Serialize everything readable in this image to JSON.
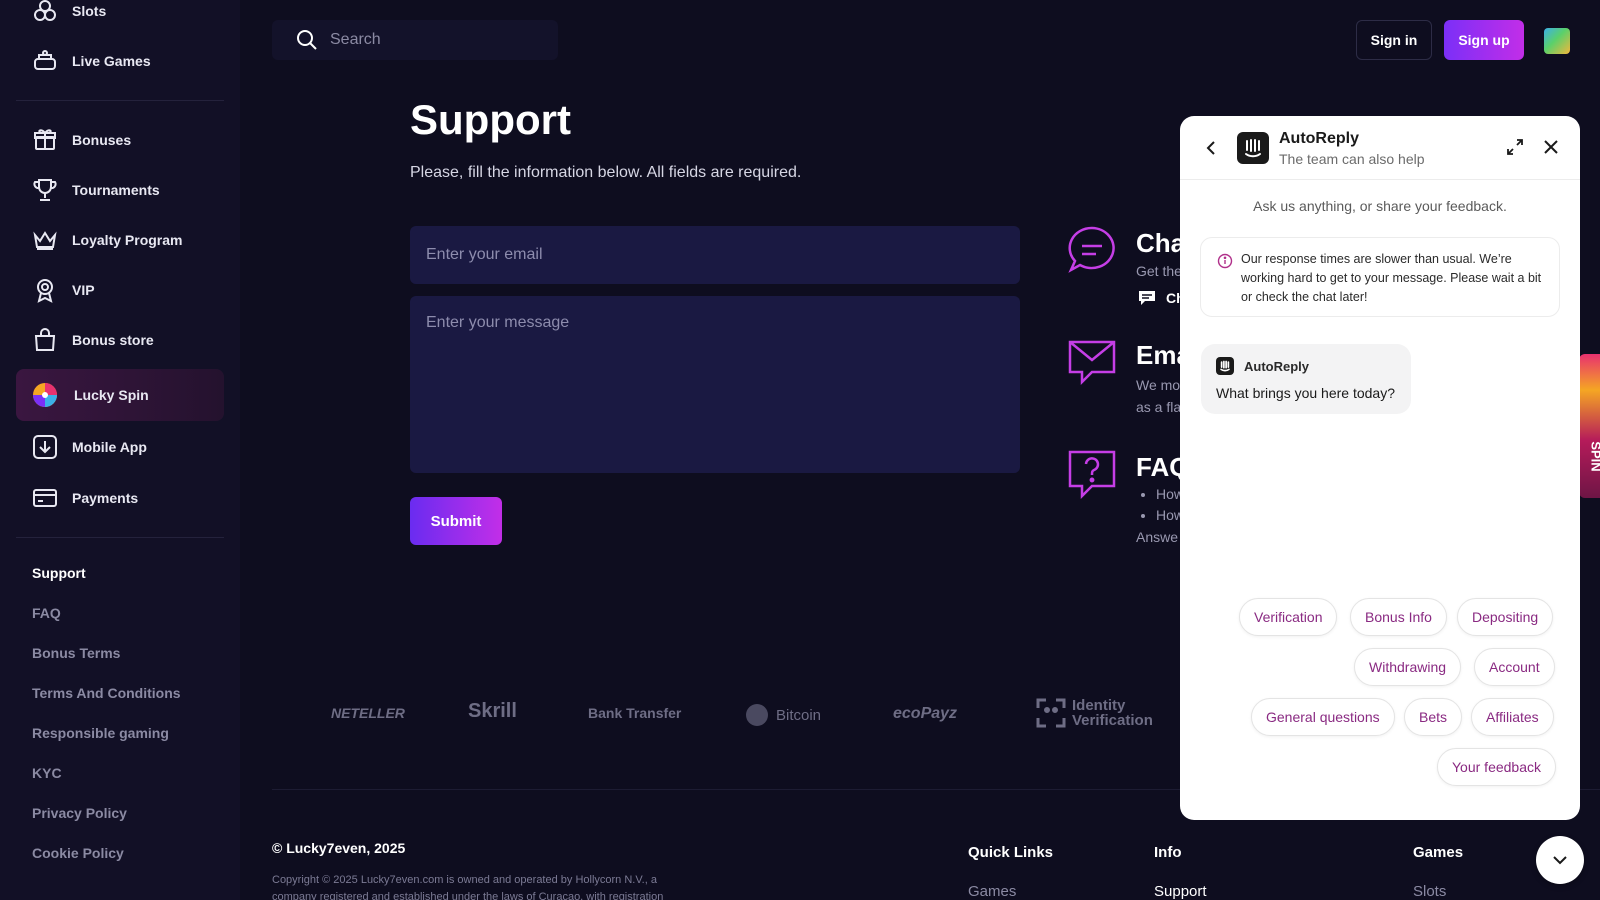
{
  "sidebar": {
    "nav": [
      {
        "label": "Slots",
        "icon": "slots-icon"
      },
      {
        "label": "Live Games",
        "icon": "live-games-icon"
      },
      {
        "label": "Bonuses",
        "icon": "gift-icon"
      },
      {
        "label": "Tournaments",
        "icon": "trophy-icon"
      },
      {
        "label": "Loyalty Program",
        "icon": "crown-icon"
      },
      {
        "label": "VIP",
        "icon": "vip-badge-icon"
      },
      {
        "label": "Bonus store",
        "icon": "shopping-bag-icon"
      },
      {
        "label": "Lucky Spin",
        "icon": "wheel-icon"
      },
      {
        "label": "Mobile App",
        "icon": "download-icon"
      },
      {
        "label": "Payments",
        "icon": "credit-card-icon"
      }
    ],
    "links": [
      "Support",
      "FAQ",
      "Bonus Terms",
      "Terms And Conditions",
      "Responsible gaming",
      "KYC",
      "Privacy Policy",
      "Cookie Policy"
    ]
  },
  "header": {
    "search_placeholder": "Search",
    "signin": "Sign in",
    "signup": "Sign up"
  },
  "main": {
    "title": "Support",
    "subtitle": "Please, fill the information below. All fields are required.",
    "email_placeholder": "Enter your email",
    "message_placeholder": "Enter your message",
    "submit": "Submit",
    "contact": {
      "chat_title": "Cha",
      "chat_text": "Get the",
      "chat_link": "Ch",
      "email_title": "Ema",
      "email_text_1": "We mo",
      "email_text_2": "as a fla",
      "faq_title": "FAQ",
      "faq_items": [
        "How",
        "How"
      ],
      "faq_text": "Answe"
    }
  },
  "payments": [
    "NETELLER",
    "Skrill",
    "Bank Transfer",
    "Bitcoin",
    "ecoPayz",
    "Identity Verification"
  ],
  "footer": {
    "copyright": "© Lucky7even, 2025",
    "legal_1": "Copyright © 2025 Lucky7even.com is owned and operated by Hollycorn N.V., a",
    "legal_2": "company registered and established under the laws of Curacao, with registration",
    "quick_links": "Quick Links",
    "info": "Info",
    "games": "Games",
    "quick_links_item": "Games",
    "info_item": "Support",
    "games_item": "Slots"
  },
  "spin_tab": "SPIN",
  "chat": {
    "name": "AutoReply",
    "status": "The team can also help",
    "intro": "Ask us anything, or share your feedback.",
    "notice": "Our response times are slower than usual. We’re working hard to get to your message. Please wait a bit or check the chat later!",
    "bubble_name": "AutoReply",
    "bubble_text": "What brings you here today?",
    "chips": [
      "Verification",
      "Bonus Info",
      "Depositing",
      "Withdrawing",
      "Account",
      "General questions",
      "Bets",
      "Affiliates",
      "Your feedback"
    ]
  },
  "colors": {
    "background": "#0e0d1f",
    "sidebar": "#121026",
    "accent_purple": "#7b2ff7",
    "accent_magenta": "#c22ee8",
    "chip_text": "#8a2a82",
    "input_bg": "#1a1942"
  }
}
